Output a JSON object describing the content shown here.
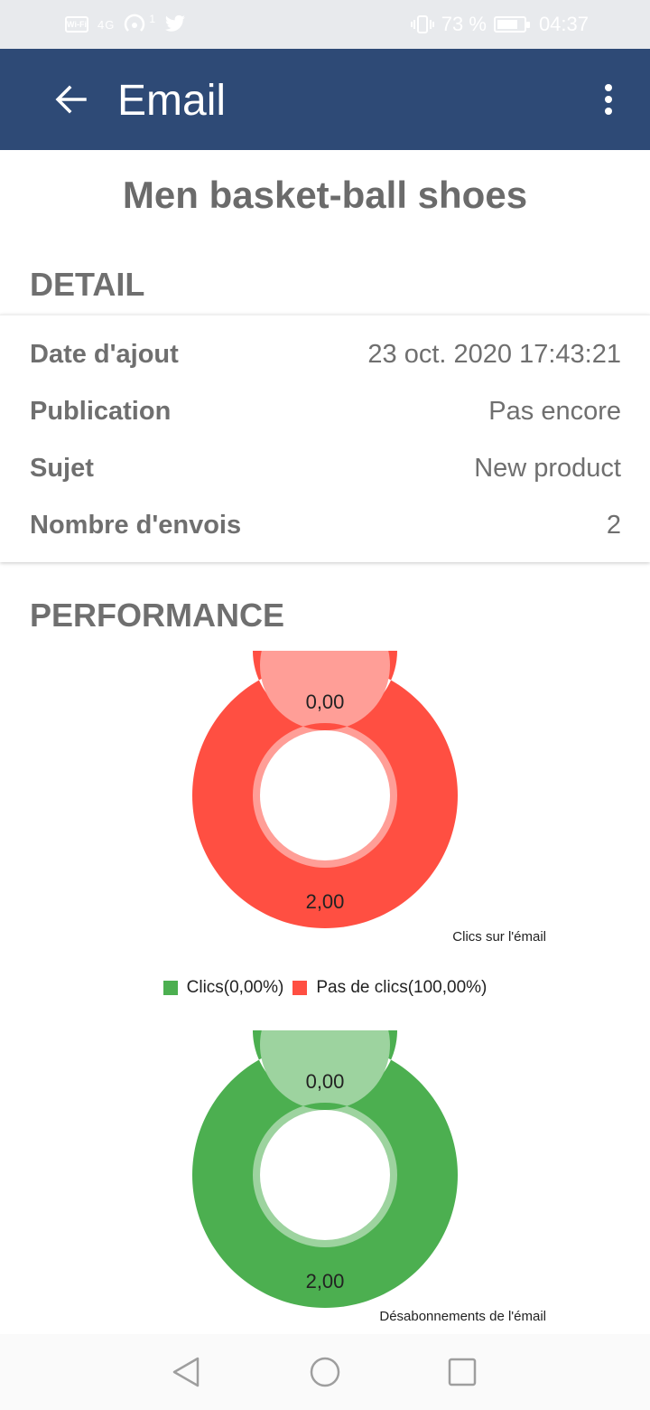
{
  "status_bar": {
    "left_badge": "Wi-Fi",
    "signal_text": "4G",
    "hotspot_sup": "1",
    "battery_percent": "73 %",
    "time": "04:37"
  },
  "app_bar": {
    "title": "Email",
    "back_icon": "arrow-left-icon",
    "menu_icon": "more-vert-icon"
  },
  "product": {
    "title": "Men basket-ball shoes"
  },
  "detail": {
    "heading": "DETAIL",
    "rows": [
      {
        "label": "Date d'ajout",
        "value": "23 oct. 2020 17:43:21"
      },
      {
        "label": "Publication",
        "value": "Pas encore"
      },
      {
        "label": "Sujet",
        "value": "New product"
      },
      {
        "label": "Nombre d'envois",
        "value": "2"
      }
    ]
  },
  "performance": {
    "heading": "PERFORMANCE"
  },
  "colors": {
    "primary": "#2e4a76",
    "red": "#ff4f42",
    "green": "#4caf50"
  },
  "chart_data": [
    {
      "type": "pie",
      "description": "Clics sur l'émail",
      "labels": [
        "Clics",
        "Pas de clics"
      ],
      "values": [
        0.0,
        2.0
      ],
      "value_labels": [
        "0,00",
        "2,00"
      ],
      "colors": [
        "#4caf50",
        "#ff4f42"
      ],
      "legend": [
        "Clics(0,00%)",
        "Pas de clics(100,00%)"
      ]
    },
    {
      "type": "pie",
      "description": "Désabonnements de l'émail",
      "values": [
        0.0,
        2.0
      ],
      "value_labels": [
        "0,00",
        "2,00"
      ],
      "colors": [
        "#4caf50",
        "#4caf50"
      ]
    }
  ],
  "nav_bar": {
    "back_icon": "triangle-back-icon",
    "home_icon": "circle-home-icon",
    "recents_icon": "square-recents-icon"
  }
}
